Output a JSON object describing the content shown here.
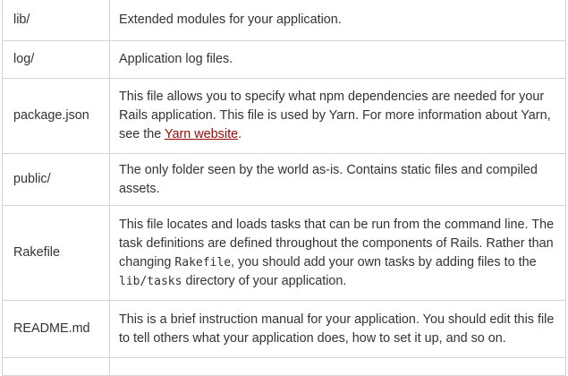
{
  "rows": [
    {
      "name": "lib/",
      "desc": "Extended modules for your application."
    },
    {
      "name": "log/",
      "desc": "Application log files."
    },
    {
      "name": "package.json",
      "desc_before": "This file allows you to specify what npm dependencies are needed for your Rails application. This file is used by Yarn. For more information about Yarn, see the ",
      "link": "Yarn website",
      "desc_after": "."
    },
    {
      "name": "public/",
      "desc": "The only folder seen by the world as-is. Contains static files and compiled assets."
    },
    {
      "name": "Rakefile",
      "desc_part1": "This file locates and loads tasks that can be run from the command line. The task definitions are defined throughout the components of Rails. Rather than changing ",
      "code1": "Rakefile",
      "desc_part2": ", you should add your own tasks by adding files to the ",
      "code2": "lib/tasks",
      "desc_part3": " directory of your application."
    },
    {
      "name": "README.md",
      "desc": "This is a brief instruction manual for your application. You should edit this file to tell others what your application does, how to set it up, and so on."
    }
  ]
}
